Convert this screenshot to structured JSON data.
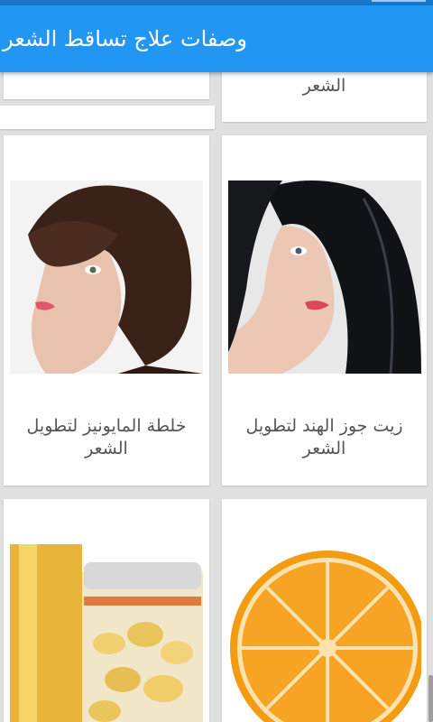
{
  "app": {
    "title": "وصفات علاج تساقط الشعر",
    "accent": "#2196f3",
    "status_bar_color": "#1976c9"
  },
  "cards": [
    {
      "id": "partial-left-top",
      "caption": "",
      "image": "none"
    },
    {
      "id": "partial-right-top",
      "caption": "الشعر",
      "image": "none"
    },
    {
      "id": "mayonnaise",
      "caption": "خلطة المايونيز لتطويل الشعر",
      "image": "brown-hair-woman"
    },
    {
      "id": "coconut",
      "caption": "زيت جوز الهند لتطويل الشعر",
      "image": "black-hair-woman"
    },
    {
      "id": "garlic",
      "caption": "",
      "image": "garlic-jar-oil"
    },
    {
      "id": "orange",
      "caption": "",
      "image": "orange-slice"
    }
  ]
}
